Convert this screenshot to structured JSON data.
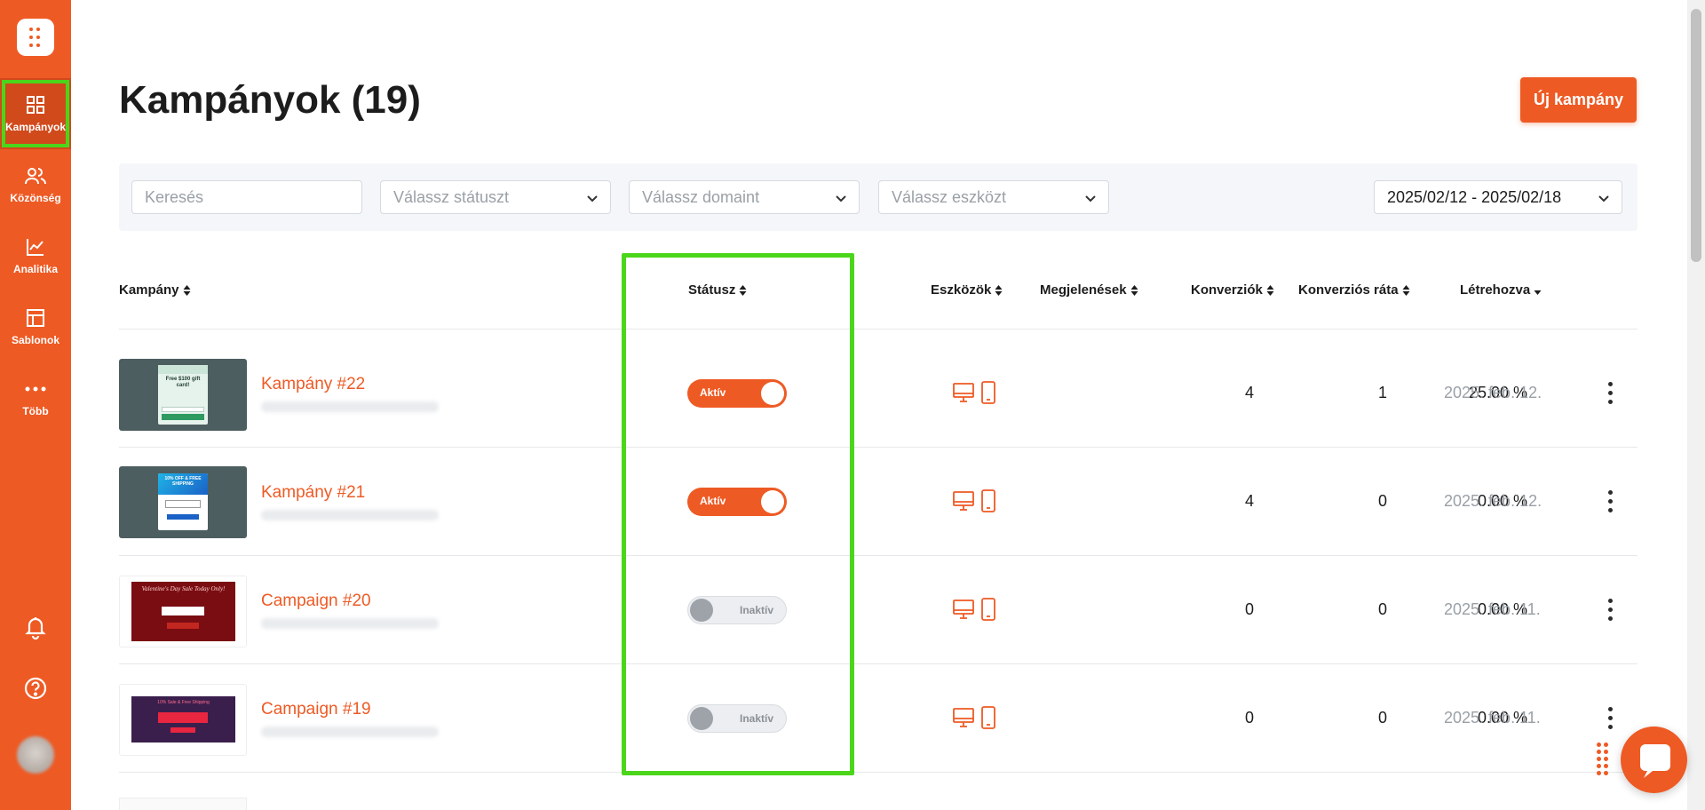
{
  "app": {
    "page_title": "Kampányok (19)",
    "new_campaign_label": "Új kampány",
    "accent_color": "#ee5a24",
    "highlight_color": "#4cd61b"
  },
  "sidebar": {
    "logo_icon": "dots-logo-icon",
    "items": [
      {
        "label": "Kampányok",
        "icon": "grid-icon",
        "active": true
      },
      {
        "label": "Közönség",
        "icon": "users-icon",
        "active": false
      },
      {
        "label": "Analitika",
        "icon": "chart-line-icon",
        "active": false
      },
      {
        "label": "Sablonok",
        "icon": "layout-icon",
        "active": false
      },
      {
        "label": "Több",
        "icon": "more-dots-icon",
        "active": false
      }
    ],
    "bottom_icons": [
      "bell-icon",
      "help-icon",
      "avatar"
    ]
  },
  "filters": {
    "search_placeholder": "Keresés",
    "status_placeholder": "Válassz státuszt",
    "domain_placeholder": "Válassz domaint",
    "device_placeholder": "Válassz eszközt",
    "date_range": "2025/02/12 - 2025/02/18"
  },
  "table": {
    "columns": [
      "Kampány",
      "Státusz",
      "Eszközök",
      "Megjelenések",
      "Konverziók",
      "Konverziós ráta",
      "Létrehozva"
    ],
    "rows": [
      {
        "name": "Kampány #22",
        "status": "Aktív",
        "active": true,
        "impressions": "4",
        "conversions": "1",
        "rate": "25.00 %",
        "created": "2025. feb. 12."
      },
      {
        "name": "Kampány #21",
        "status": "Aktív",
        "active": true,
        "impressions": "4",
        "conversions": "0",
        "rate": "0.00 %",
        "created": "2025. feb. 12."
      },
      {
        "name": "Campaign #20",
        "status": "Inaktív",
        "active": false,
        "impressions": "0",
        "conversions": "0",
        "rate": "0.00 %",
        "created": "2025. feb. 11."
      },
      {
        "name": "Campaign #19",
        "status": "Inaktív",
        "active": false,
        "impressions": "0",
        "conversions": "0",
        "rate": "0.00 %",
        "created": "2025. feb. 11."
      }
    ],
    "thumbnails": [
      {
        "headline": "Free $100 gift card!"
      },
      {
        "headline": "10% OFF & FREE SHIPPING"
      },
      {
        "headline": "Valentine's Day Sale Today Only!"
      },
      {
        "headline": "10% Sale & Free Shipping"
      }
    ]
  }
}
